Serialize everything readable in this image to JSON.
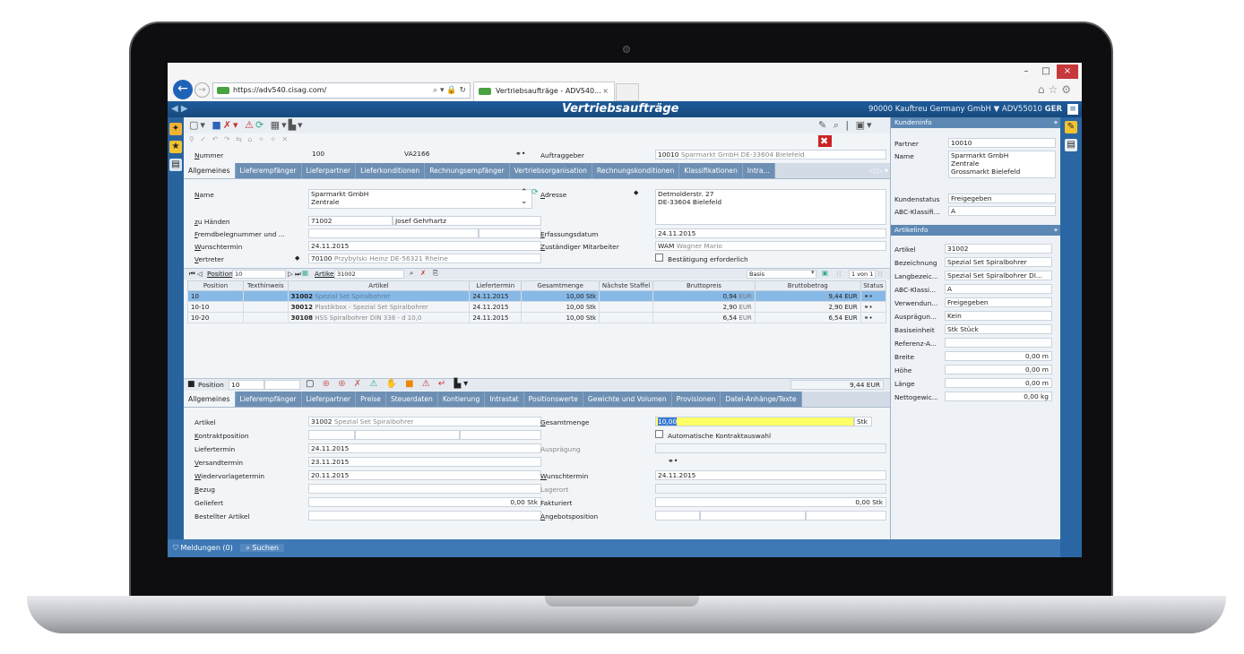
{
  "browser": {
    "url": "https://adv540.cisag.com/",
    "tab_title": "Vertriebsaufträge - ADV540...",
    "minimize": "–",
    "maximize": "□",
    "close": "×"
  },
  "app": {
    "title": "Vertriebsaufträge",
    "context": "90000  Kauftreu Germany GmbH ▼  ADV55010",
    "lang": "GER"
  },
  "header": {
    "nummer_label": "Nummer",
    "nummer": "100",
    "nummer2": "VA2166",
    "auftraggeber_label": "Auftraggeber",
    "auftraggeber": "10010",
    "auftraggeber_name": "Sparmarkt GmbH DE-33604 Bielefeld"
  },
  "tabs_top": [
    "Allgemeines",
    "Lieferempfänger",
    "Lieferpartner",
    "Lieferkonditionen",
    "Rechnungsempfänger",
    "Vertriebsorganisation",
    "Rechnungskonditionen",
    "Klassifikationen",
    "Intra..."
  ],
  "general": {
    "name_label": "Name",
    "name1": "Sparmarkt GmbH",
    "name2": "Zentrale",
    "adresse_label": "Adresse",
    "adresse1": "Detmolderstr. 27",
    "adresse2": "DE-33604 Bielefeld",
    "zuhanden_label": "zu Händen",
    "zuhanden_nr": "71002",
    "zuhanden_name": "Josef Gehrhartz",
    "fremd_label": "Fremdbelegnummer und ...",
    "wunsch_label": "Wunschtermin",
    "wunsch": "24.11.2015",
    "erfassung_label": "Erfassungsdatum",
    "erfassung": "24.11.2015",
    "vertreter_label": "Vertreter",
    "vertreter_nr": "70100",
    "vertreter_name": "Przybylski Heinz DE-56321 Rheine",
    "mitarbeiter_label": "Zuständiger Mitarbeiter",
    "mitarbeiter_code": "WAM",
    "mitarbeiter_name": "Wagner Mario",
    "bestaetigung_label": "Bestätigung erforderlich"
  },
  "posnav": {
    "position_label": "Position",
    "position": "10",
    "artikel_label": "Artikel",
    "artikel": "31002",
    "basis": "Basis",
    "pager": "1 von 1"
  },
  "table": {
    "headers": [
      "Position",
      "Texthinweis",
      "Artikel",
      "Liefertermin",
      "Gesamtmenge",
      "Nächste Staffel",
      "Bruttopreis",
      "Bruttobetrag",
      "Status"
    ],
    "rows": [
      {
        "pos": "10",
        "art": "31002",
        "art_desc": "Spezial Set Spiralbohrer",
        "date": "24.11.2015",
        "menge": "10,00 Stk",
        "preis": "0,94",
        "cur": "EUR",
        "betrag": "9,44 EUR"
      },
      {
        "pos": "10-10",
        "art": "30012",
        "art_desc": "Plastikbox - Spezial Set Spiralbohrer",
        "date": "24.11.2015",
        "menge": "10,00 Stk",
        "preis": "2,90",
        "cur": "EUR",
        "betrag": "2,90 EUR"
      },
      {
        "pos": "10-20",
        "art": "30108",
        "art_desc": "HSS Spiralbohrer DIN 338 - d 10,0",
        "date": "24.11.2015",
        "menge": "10,00 Stk",
        "preis": "6,54",
        "cur": "EUR",
        "betrag": "6,54 EUR"
      }
    ]
  },
  "posbar": {
    "label": "Position",
    "value": "10",
    "total": "9,44 EUR"
  },
  "tabs_pos": [
    "Allgemeines",
    "Lieferempfänger",
    "Lieferpartner",
    "Preise",
    "Steuerdaten",
    "Kontierung",
    "Intrastat",
    "Positionswerte",
    "Gewichte und Volumen",
    "Provisionen",
    "Datei-Anhänge/Texte"
  ],
  "posdetail": {
    "artikel_label": "Artikel",
    "artikel": "31002",
    "artikel_desc": "Spezial Set Spiralbohrer",
    "kontrakt_label": "Kontraktposition",
    "liefer_label": "Liefertermin",
    "liefer": "24.11.2015",
    "versand_label": "Versandtermin",
    "versand": "23.11.2015",
    "wieder_label": "Wiedervorlagetermin",
    "wieder": "20.11.2015",
    "bezug_label": "Bezug",
    "geliefert_label": "Geliefert",
    "geliefert": "0,00 Stk",
    "bestellt_label": "Bestellter Artikel",
    "gesamt_label": "Gesamtmenge",
    "gesamt": "10,00",
    "gesamt_unit": "Stk",
    "auto_label": "Automatische Kontraktauswahl",
    "auspraegung_label": "Ausprägung",
    "wunsch_label": "Wunschtermin",
    "wunsch": "24.11.2015",
    "lagerort_label": "Lagerort",
    "fakturiert_label": "Fakturiert",
    "fakturiert": "0,00 Stk",
    "angebot_label": "Angebotsposition"
  },
  "kundeninfo": {
    "title": "Kundeninfo",
    "partner_label": "Partner",
    "partner": "10010",
    "name_label": "Name",
    "name1": "Sparmarkt GmbH",
    "name2": "Zentrale",
    "name3": "Grossmarkt Bielefeld",
    "status_label": "Kundenstatus",
    "status": "Freigegeben",
    "abc_label": "ABC-Klassifi...",
    "abc": "A"
  },
  "artikelinfo": {
    "title": "Artikelinfo",
    "rows": [
      {
        "label": "Artikel",
        "value": "31002"
      },
      {
        "label": "Bezeichnung",
        "value": "Spezial Set Spiralbohrer"
      },
      {
        "label": "Langbezeic...",
        "value": "Spezial Set Spiralbohrer DI..."
      },
      {
        "label": "ABC-Klassi...",
        "value": "A"
      },
      {
        "label": "Verwendun...",
        "value": "Freigegeben"
      },
      {
        "label": "Ausprägun...",
        "value": "Kein"
      },
      {
        "label": "Basiseinheit",
        "value": "Stk Stück"
      },
      {
        "label": "Referenz-A...",
        "value": ""
      },
      {
        "label": "Breite",
        "value": "0,00 m"
      },
      {
        "label": "Höhe",
        "value": "0,00 m"
      },
      {
        "label": "Länge",
        "value": "0,00 m"
      },
      {
        "label": "Nettogewic...",
        "value": "0,00 kg"
      }
    ]
  },
  "statusbar": {
    "meldungen": "Meldungen (0)",
    "suchen": "Suchen"
  },
  "colors": {
    "accent": "#1e5c9a",
    "selected_row": "#87b9e6",
    "highlight_input": "#ffff66"
  }
}
